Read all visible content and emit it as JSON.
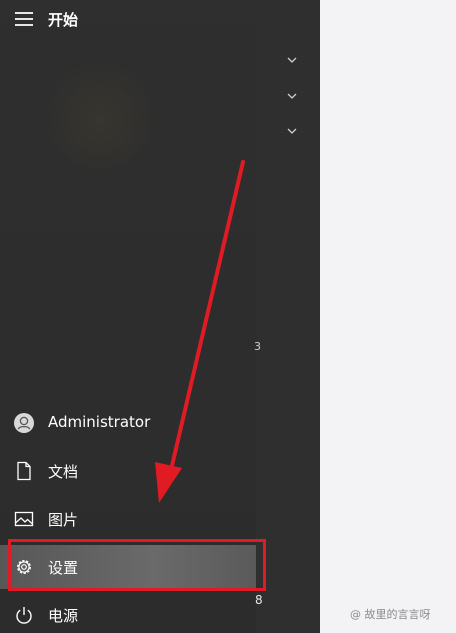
{
  "header": {
    "title": "开始",
    "menu_icon": "hamburger-icon"
  },
  "chevrons": [
    "chevron-down-icon",
    "chevron-down-icon",
    "chevron-down-icon"
  ],
  "side_marks": {
    "mark_top": "3",
    "mark_bottom": "8"
  },
  "menu": {
    "user": {
      "label": "Administrator",
      "icon": "user-avatar-icon"
    },
    "documents": {
      "label": "文档",
      "icon": "document-icon"
    },
    "pictures": {
      "label": "图片",
      "icon": "picture-icon"
    },
    "settings": {
      "label": "设置",
      "icon": "gear-icon"
    },
    "power": {
      "label": "电源",
      "icon": "power-icon"
    }
  },
  "annotation": {
    "color": "#e01b24"
  },
  "watermark": "@ 故里的言言呀"
}
